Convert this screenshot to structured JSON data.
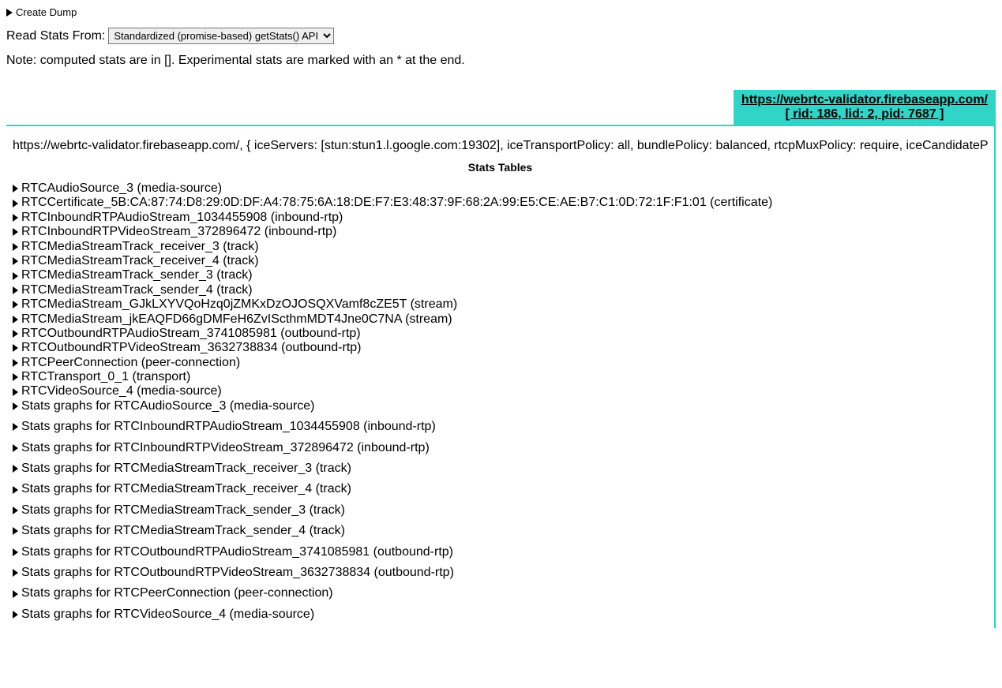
{
  "create_dump_label": "Create Dump",
  "read_stats_label": "Read Stats From:",
  "read_stats_select": "Standardized (promise-based) getStats() API",
  "note_text": "Note: computed stats are in []. Experimental stats are marked with an * at the end.",
  "tab": {
    "url": "https://webrtc-validator.firebaseapp.com/",
    "ids": "[ rid: 186, lid: 2, pid: 7687 ]"
  },
  "connection_info": "https://webrtc-validator.firebaseapp.com/, { iceServers: [stun:stun1.l.google.com:19302], iceTransportPolicy: all, bundlePolicy: balanced, rtcpMuxPolicy: require, iceCandidatePoo",
  "stats_tables_header": "Stats Tables",
  "stats": [
    "RTCAudioSource_3 (media-source)",
    "RTCCertificate_5B:CA:87:74:D8:29:0D:DF:A4:78:75:6A:18:DE:F7:E3:48:37:9F:68:2A:99:E5:CE:AE:B7:C1:0D:72:1F:F1:01 (certificate)",
    "RTCInboundRTPAudioStream_1034455908 (inbound-rtp)",
    "RTCInboundRTPVideoStream_372896472 (inbound-rtp)",
    "RTCMediaStreamTrack_receiver_3 (track)",
    "RTCMediaStreamTrack_receiver_4 (track)",
    "RTCMediaStreamTrack_sender_3 (track)",
    "RTCMediaStreamTrack_sender_4 (track)",
    "RTCMediaStream_GJkLXYVQoHzq0jZMKxDzOJOSQXVamf8cZE5T (stream)",
    "RTCMediaStream_jkEAQFD66gDMFeH6ZvIScthmMDT4Jne0C7NA (stream)",
    "RTCOutboundRTPAudioStream_3741085981 (outbound-rtp)",
    "RTCOutboundRTPVideoStream_3632738834 (outbound-rtp)",
    "RTCPeerConnection (peer-connection)",
    "RTCTransport_0_1 (transport)",
    "RTCVideoSource_4 (media-source)"
  ],
  "graphs": [
    "Stats graphs for RTCAudioSource_3 (media-source)",
    "Stats graphs for RTCInboundRTPAudioStream_1034455908 (inbound-rtp)",
    "Stats graphs for RTCInboundRTPVideoStream_372896472 (inbound-rtp)",
    "Stats graphs for RTCMediaStreamTrack_receiver_3 (track)",
    "Stats graphs for RTCMediaStreamTrack_receiver_4 (track)",
    "Stats graphs for RTCMediaStreamTrack_sender_3 (track)",
    "Stats graphs for RTCMediaStreamTrack_sender_4 (track)",
    "Stats graphs for RTCOutboundRTPAudioStream_3741085981 (outbound-rtp)",
    "Stats graphs for RTCOutboundRTPVideoStream_3632738834 (outbound-rtp)",
    "Stats graphs for RTCPeerConnection (peer-connection)",
    "Stats graphs for RTCVideoSource_4 (media-source)"
  ]
}
